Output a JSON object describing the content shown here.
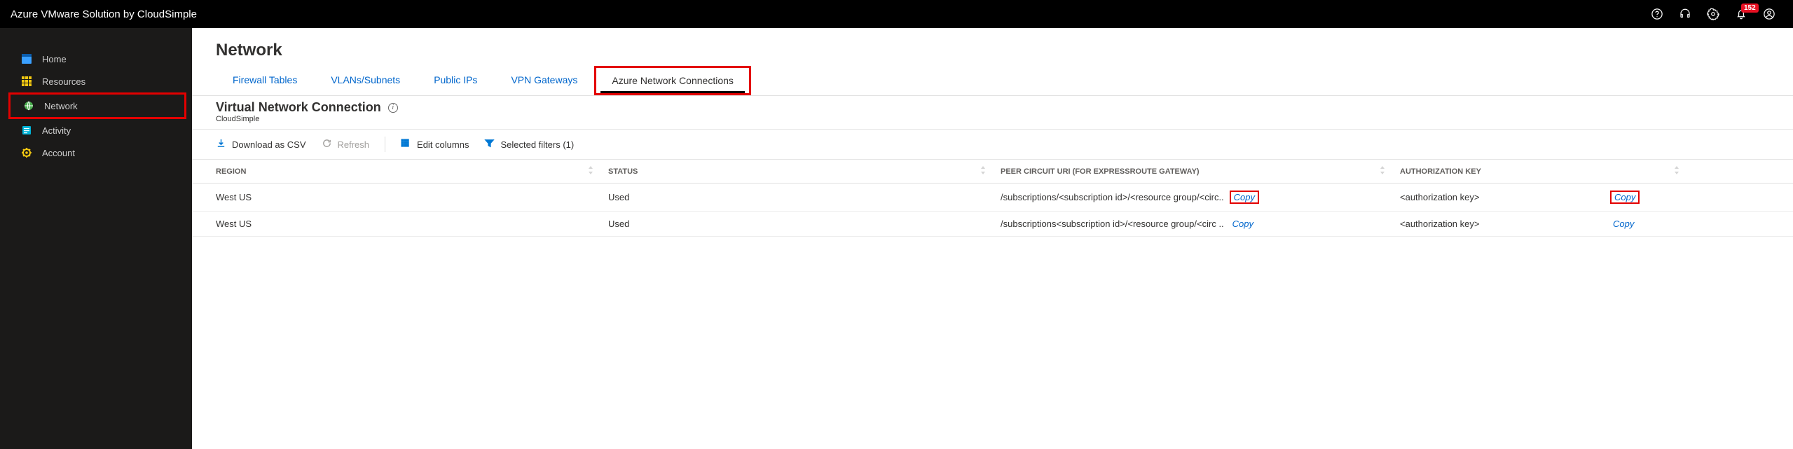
{
  "app_title": "Azure VMware Solution by CloudSimple",
  "notification_count": "152",
  "sidebar": {
    "items": [
      {
        "label": "Home"
      },
      {
        "label": "Resources"
      },
      {
        "label": "Network"
      },
      {
        "label": "Activity"
      },
      {
        "label": "Account"
      }
    ]
  },
  "page": {
    "title": "Network",
    "subtitle": "Virtual Network Connection",
    "tenant": "CloudSimple"
  },
  "tabs": [
    {
      "label": "Firewall Tables"
    },
    {
      "label": "VLANs/Subnets"
    },
    {
      "label": "Public IPs"
    },
    {
      "label": "VPN Gateways"
    },
    {
      "label": "Azure Network Connections"
    }
  ],
  "commands": {
    "download": "Download as CSV",
    "refresh": "Refresh",
    "edit_columns": "Edit columns",
    "filters": "Selected filters (1)"
  },
  "table": {
    "headers": {
      "region": "REGION",
      "status": "STATUS",
      "uri": "PEER CIRCUIT URI (FOR EXPRESSROUTE GATEWAY)",
      "auth": "AUTHORIZATION KEY"
    },
    "rows": [
      {
        "region": "West US",
        "status": "Used",
        "uri_prefix": "/subscriptions/",
        "uri_rest": "<subscription id>/<resource group/<circ..",
        "copy_uri": "Copy",
        "auth": "<authorization key>",
        "copy_auth": "Copy"
      },
      {
        "region": "West US",
        "status": "Used",
        "uri_prefix": "/subscriptions",
        "uri_rest": "<subscription id>/<resource group/<circ ..",
        "copy_uri": "Copy",
        "auth": "<authorization key>",
        "copy_auth": "Copy"
      }
    ]
  }
}
